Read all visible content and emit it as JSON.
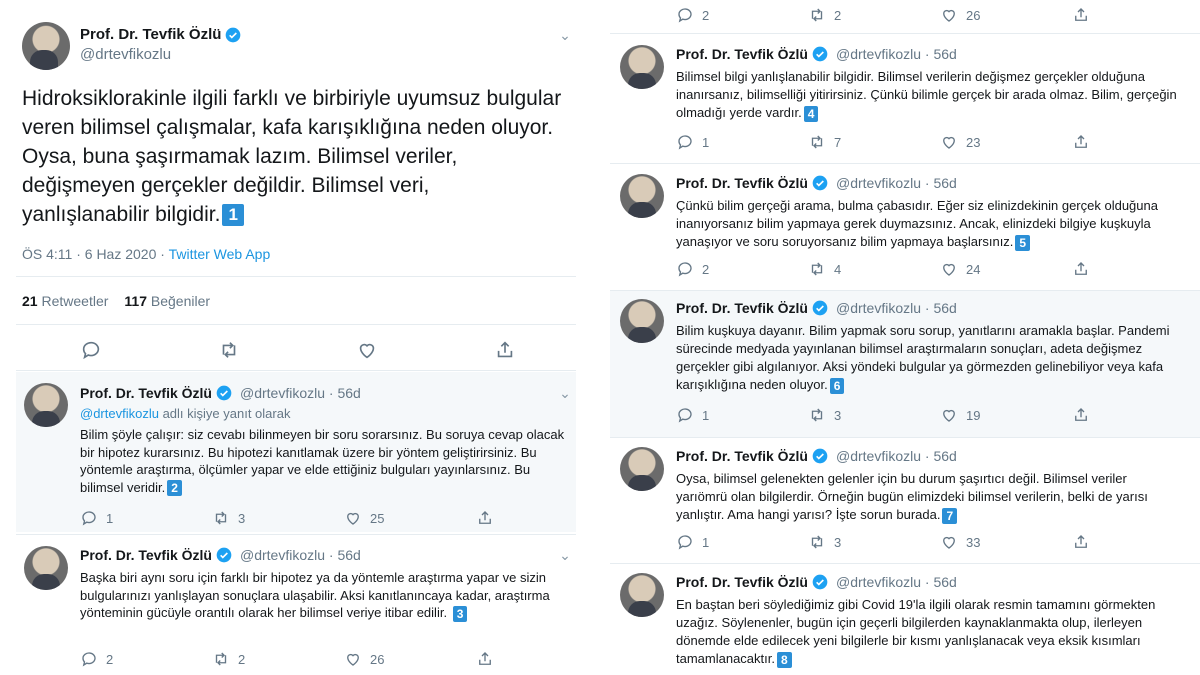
{
  "author": {
    "name": "Prof. Dr. Tevfik Özlü",
    "handle": "@drtevfikozlu",
    "handle_time": "@drtevfikozlu · 56d"
  },
  "main_tweet": {
    "text": "Hidroksiklorakinle ilgili farklı ve birbiriyle uyumsuz bulgular veren bilimsel çalışmalar, kafa karışıklığına neden oluyor. Oysa, buna şaşırmamak lazım. Bilimsel veriler, değişmeyen gerçekler değildir. Bilimsel veri, yanlışlanabilir bilgidir.",
    "badge": "1",
    "time": "ÖS 4:11 · 6 Haz 2020 · ",
    "source": "Twitter Web App",
    "retweets_count": "21",
    "retweets_label": "Retweetler",
    "likes_count": "117",
    "likes_label": "Beğeniler"
  },
  "reply_label": {
    "handle": "@drtevfikozlu",
    "suffix": " adlı kişiye yanıt olarak"
  },
  "top_partial_counts": {
    "reply": "2",
    "retweet": "2",
    "like": "26"
  },
  "thread": [
    {
      "text": "Bilim şöyle çalışır: siz cevabı bilinmeyen bir soru sorarsınız. Bu soruya cevap olacak bir hipotez kurarsınız. Bu hipotezi kanıtlamak üzere bir yöntem geliştirirsiniz. Bu yöntemle araştırma, ölçümler yapar ve elde ettiğiniz bulguları yayınlarsınız. Bu bilimsel veridir.",
      "badge": "2",
      "reply": "1",
      "retweet": "3",
      "like": "25"
    },
    {
      "text": "Başka biri aynı soru için farklı bir hipotez ya da yöntemle araştırma yapar ve sizin bulgularınızı yanlışlayan sonuçlara ulaşabilir. Aksi kanıtlanıncaya kadar, araştırma yönteminin gücüyle orantılı olarak her bilimsel veriye itibar edilir.",
      "badge": "3",
      "reply": "2",
      "retweet": "2",
      "like": "26"
    },
    {
      "text": "Bilimsel bilgi yanlışlanabilir bilgidir. Bilimsel verilerin değişmez gerçekler olduğuna inanırsanız, bilimselliği yitirirsiniz. Çünkü bilimle gerçek bir arada olmaz. Bilim, gerçeğin olmadığı yerde vardır.",
      "badge": "4",
      "reply": "1",
      "retweet": "7",
      "like": "23"
    },
    {
      "text": "Çünkü bilim gerçeği arama, bulma çabasıdır. Eğer siz elinizdekinin gerçek olduğuna inanıyorsanız bilim yapmaya gerek duymazsınız. Ancak, elinizdeki bilgiye kuşkuyla yanaşıyor ve soru soruyorsanız bilim yapmaya başlarsınız.",
      "badge": "5",
      "reply": "2",
      "retweet": "4",
      "like": "24"
    },
    {
      "text": "Bilim kuşkuya dayanır. Bilim yapmak soru sorup, yanıtlarını aramakla başlar. Pandemi sürecinde medyada yayınlanan bilimsel araştırmaların sonuçları, adeta değişmez gerçekler gibi algılanıyor. Aksi yöndeki bulgular ya görmezden gelinebiliyor veya kafa karışıklığına neden oluyor.",
      "badge": "6",
      "reply": "1",
      "retweet": "3",
      "like": "19"
    },
    {
      "text": "Oysa, bilimsel gelenekten gelenler için bu durum şaşırtıcı değil. Bilimsel veriler yarıömrü olan bilgilerdir. Örneğin bugün elimizdeki bilimsel verilerin, belki de yarısı yanlıştır. Ama hangi yarısı? İşte sorun burada.",
      "badge": "7",
      "reply": "1",
      "retweet": "3",
      "like": "33"
    },
    {
      "text": "En baştan beri söylediğimiz gibi Covid 19'la ilgili olarak resmin tamamını görmekten uzağız. Söylenenler, bugün için geçerli bilgilerden kaynaklanmakta olup, ilerleyen dönemde elde edilecek yeni bilgilerle bir kısmı yanlışlanacak veya eksik kısımları tamamlanacaktır.",
      "badge": "8"
    }
  ],
  "colors": {
    "accent": "#1b95e0",
    "badge": "#2b8fd6",
    "muted": "#657786",
    "reply_bg": "#f5f8fa"
  },
  "icons": [
    "verified-icon",
    "chevron-down-icon",
    "reply-icon",
    "retweet-icon",
    "like-icon",
    "share-icon"
  ]
}
